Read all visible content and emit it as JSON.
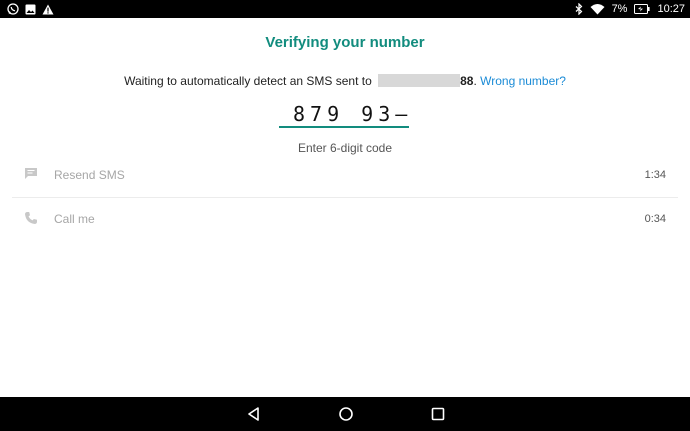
{
  "status_bar": {
    "left_icons": [
      "whatsapp-icon",
      "image-icon",
      "warning-icon"
    ],
    "right_icons": [
      "bluetooth-icon",
      "wifi-icon",
      "battery-icon"
    ],
    "battery": "7%",
    "time": "10:27"
  },
  "header": {
    "title": "Verifying your number"
  },
  "message": {
    "prefix": "Waiting to automatically detect an SMS sent to ",
    "number_suffix": "88",
    "separator": ". ",
    "wrong_number_link": "Wrong number?"
  },
  "code_input": {
    "value": "879 93–",
    "hint": "Enter 6-digit code"
  },
  "actions": {
    "resend": {
      "label": "Resend SMS",
      "timer": "1:34"
    },
    "call": {
      "label": "Call me",
      "timer": "0:34"
    }
  },
  "nav_bar": {
    "icons": [
      "back-icon",
      "home-icon",
      "recent-apps-icon"
    ]
  },
  "colors": {
    "accent": "#128c7e",
    "link": "#1b8bd6",
    "bar_background": "#000000"
  }
}
